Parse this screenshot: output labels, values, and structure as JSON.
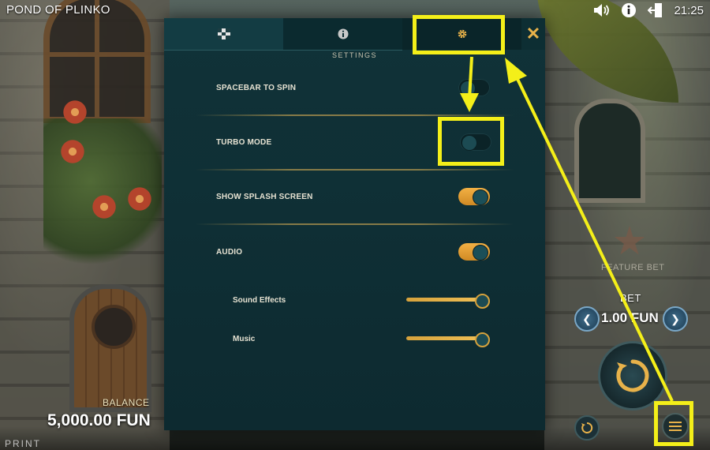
{
  "app": {
    "title": "POND OF PLINKO",
    "clock": "21:25"
  },
  "topbar": {
    "icons": [
      "speaker-icon",
      "info-icon",
      "exit-icon"
    ]
  },
  "hud": {
    "balance_label": "BALANCE",
    "balance_value": "5,000.00 FUN",
    "print_label": "PRINT",
    "feature_bet_label": "FEATURE BET",
    "bet_label": "BET",
    "bet_value": "1.00 FUN"
  },
  "settings": {
    "tabs": [
      {
        "icon": "paytable-icon",
        "active": false
      },
      {
        "icon": "info-icon",
        "active": false
      },
      {
        "icon": "gear-icon",
        "active": true
      }
    ],
    "close_label": "✕",
    "section_title": "SETTINGS",
    "options": [
      {
        "label": "SPACEBAR TO SPIN",
        "enabled": false
      },
      {
        "label": "TURBO MODE",
        "enabled": false
      },
      {
        "label": "SHOW SPLASH SCREEN",
        "enabled": true
      },
      {
        "label": "AUDIO",
        "enabled": true
      }
    ],
    "volumes": [
      {
        "label": "Sound Effects",
        "level": 1.0
      },
      {
        "label": "Music",
        "level": 1.0
      }
    ]
  },
  "colors": {
    "accent": "#e8b24a",
    "panel": "#103238",
    "highlight": "#f4ef19"
  }
}
